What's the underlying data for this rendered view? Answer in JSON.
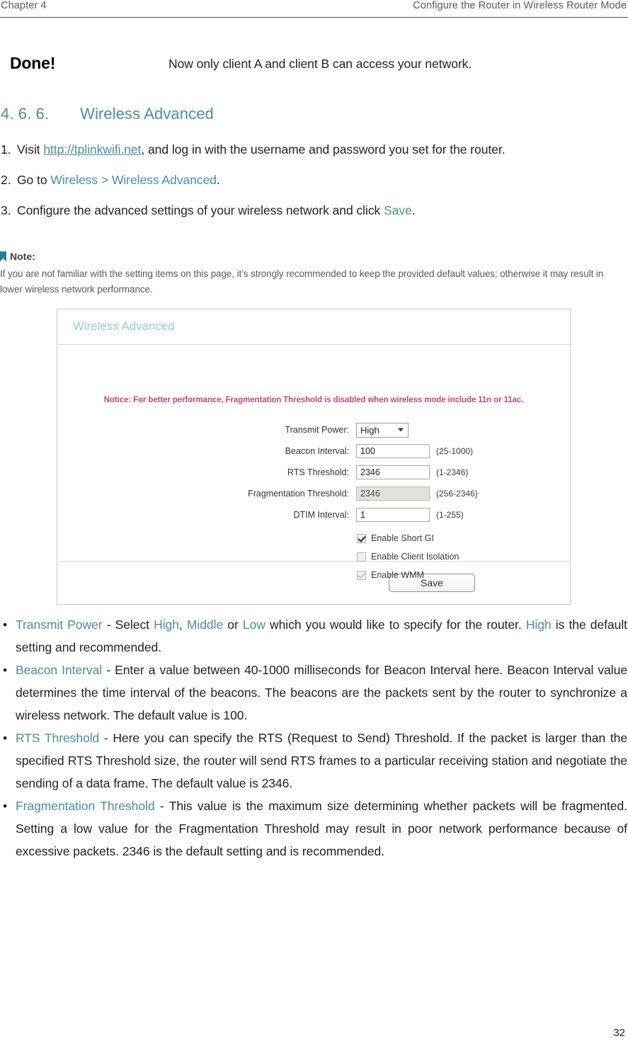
{
  "header": {
    "chapter": "Chapter 4",
    "title": "Configure the Router in Wireless Router Mode"
  },
  "done": {
    "label": "Done!",
    "text": "Now only client A and client B can access your network."
  },
  "section": {
    "number": "4. 6. 6.",
    "title": "Wireless Advanced"
  },
  "steps": [
    {
      "marker": "1.",
      "pre": "Visit ",
      "link": "http://tplinkwifi.net",
      "post": ", and log in with the username and password you set for the router."
    },
    {
      "marker": "2.",
      "pre": "Go to ",
      "link1": "Wireless",
      "sep": " > ",
      "link2": "Wireless Advanced",
      "post": "."
    },
    {
      "marker": "3.",
      "pre": "Configure the advanced settings of your wireless network and click ",
      "link": "Save",
      "post": "."
    }
  ],
  "note": {
    "label": "Note:",
    "body": "If you are not familiar with the setting items on this page, it’s strongly recommended to keep the provided default values; otherwise it may result in lower wireless network performance."
  },
  "ui": {
    "panel_title": "Wireless Advanced",
    "notice": "Notice: For better performance, Fragmentation Threshold is disabled when wireless mode include 11n or 11ac.",
    "fields": [
      {
        "label": "Transmit Power:",
        "type": "select",
        "value": "High",
        "hint": ""
      },
      {
        "label": "Beacon Interval:",
        "type": "text",
        "value": "100",
        "hint": "(25-1000)"
      },
      {
        "label": "RTS Threshold:",
        "type": "text",
        "value": "2346",
        "hint": "(1-2346)"
      },
      {
        "label": "Fragmentation Threshold:",
        "type": "text-disabled",
        "value": "2346",
        "hint": "(256-2346)"
      },
      {
        "label": "DTIM Interval:",
        "type": "text",
        "value": "1",
        "hint": "(1-255)"
      }
    ],
    "checkboxes": [
      {
        "label": "Enable Short GI",
        "checked": true,
        "dim": false
      },
      {
        "label": "Enable Client Isolation",
        "checked": false,
        "dim": false
      },
      {
        "label": "Enable WMM",
        "checked": true,
        "dim": true
      }
    ],
    "save_label": "Save",
    "select_options": [
      "High",
      "Middle",
      "Low"
    ]
  },
  "bullets": [
    {
      "term": "Transmit Power",
      "body_parts": [
        {
          "t": " - Select ",
          "c": "dark"
        },
        {
          "t": "High",
          "c": "teal"
        },
        {
          "t": ", ",
          "c": "dark"
        },
        {
          "t": "Middle",
          "c": "teal"
        },
        {
          "t": " or ",
          "c": "dark"
        },
        {
          "t": "Low",
          "c": "teal"
        },
        {
          "t": " which you would like to specify for the router. ",
          "c": "dark"
        },
        {
          "t": "High",
          "c": "teal"
        },
        {
          "t": " is the default setting and recommended.",
          "c": "dark"
        }
      ]
    },
    {
      "term": "Beacon Interval",
      "body_parts": [
        {
          "t": " - Enter a value between 40-1000 milliseconds for Beacon Interval here. Beacon Interval value determines the time interval of the beacons. The beacons are the packets sent by the router to synchronize a wireless network. The default value is 100.",
          "c": "dark"
        }
      ]
    },
    {
      "term": "RTS Threshold",
      "body_parts": [
        {
          "t": " - Here you can specify the RTS (Request to Send) Threshold. If the packet is larger than the specified RTS Threshold size, the router will send RTS frames to a particular receiving station and negotiate the sending of a data frame. The default value is 2346.",
          "c": "dark"
        }
      ]
    },
    {
      "term": "Fragmentation Threshold",
      "body_parts": [
        {
          "t": " - This value is the maximum size determining whether packets will be fragmented. Setting a low value for the Fragmentation Threshold may result in poor network performance because of excessive packets. 2346 is the default setting and is recommended.",
          "c": "dark"
        }
      ]
    }
  ],
  "footer": {
    "page_number": "32"
  },
  "colors": {
    "teal": "#4a8d9f",
    "panel_title": "#8fcdd6",
    "notice": "#c2477e"
  }
}
